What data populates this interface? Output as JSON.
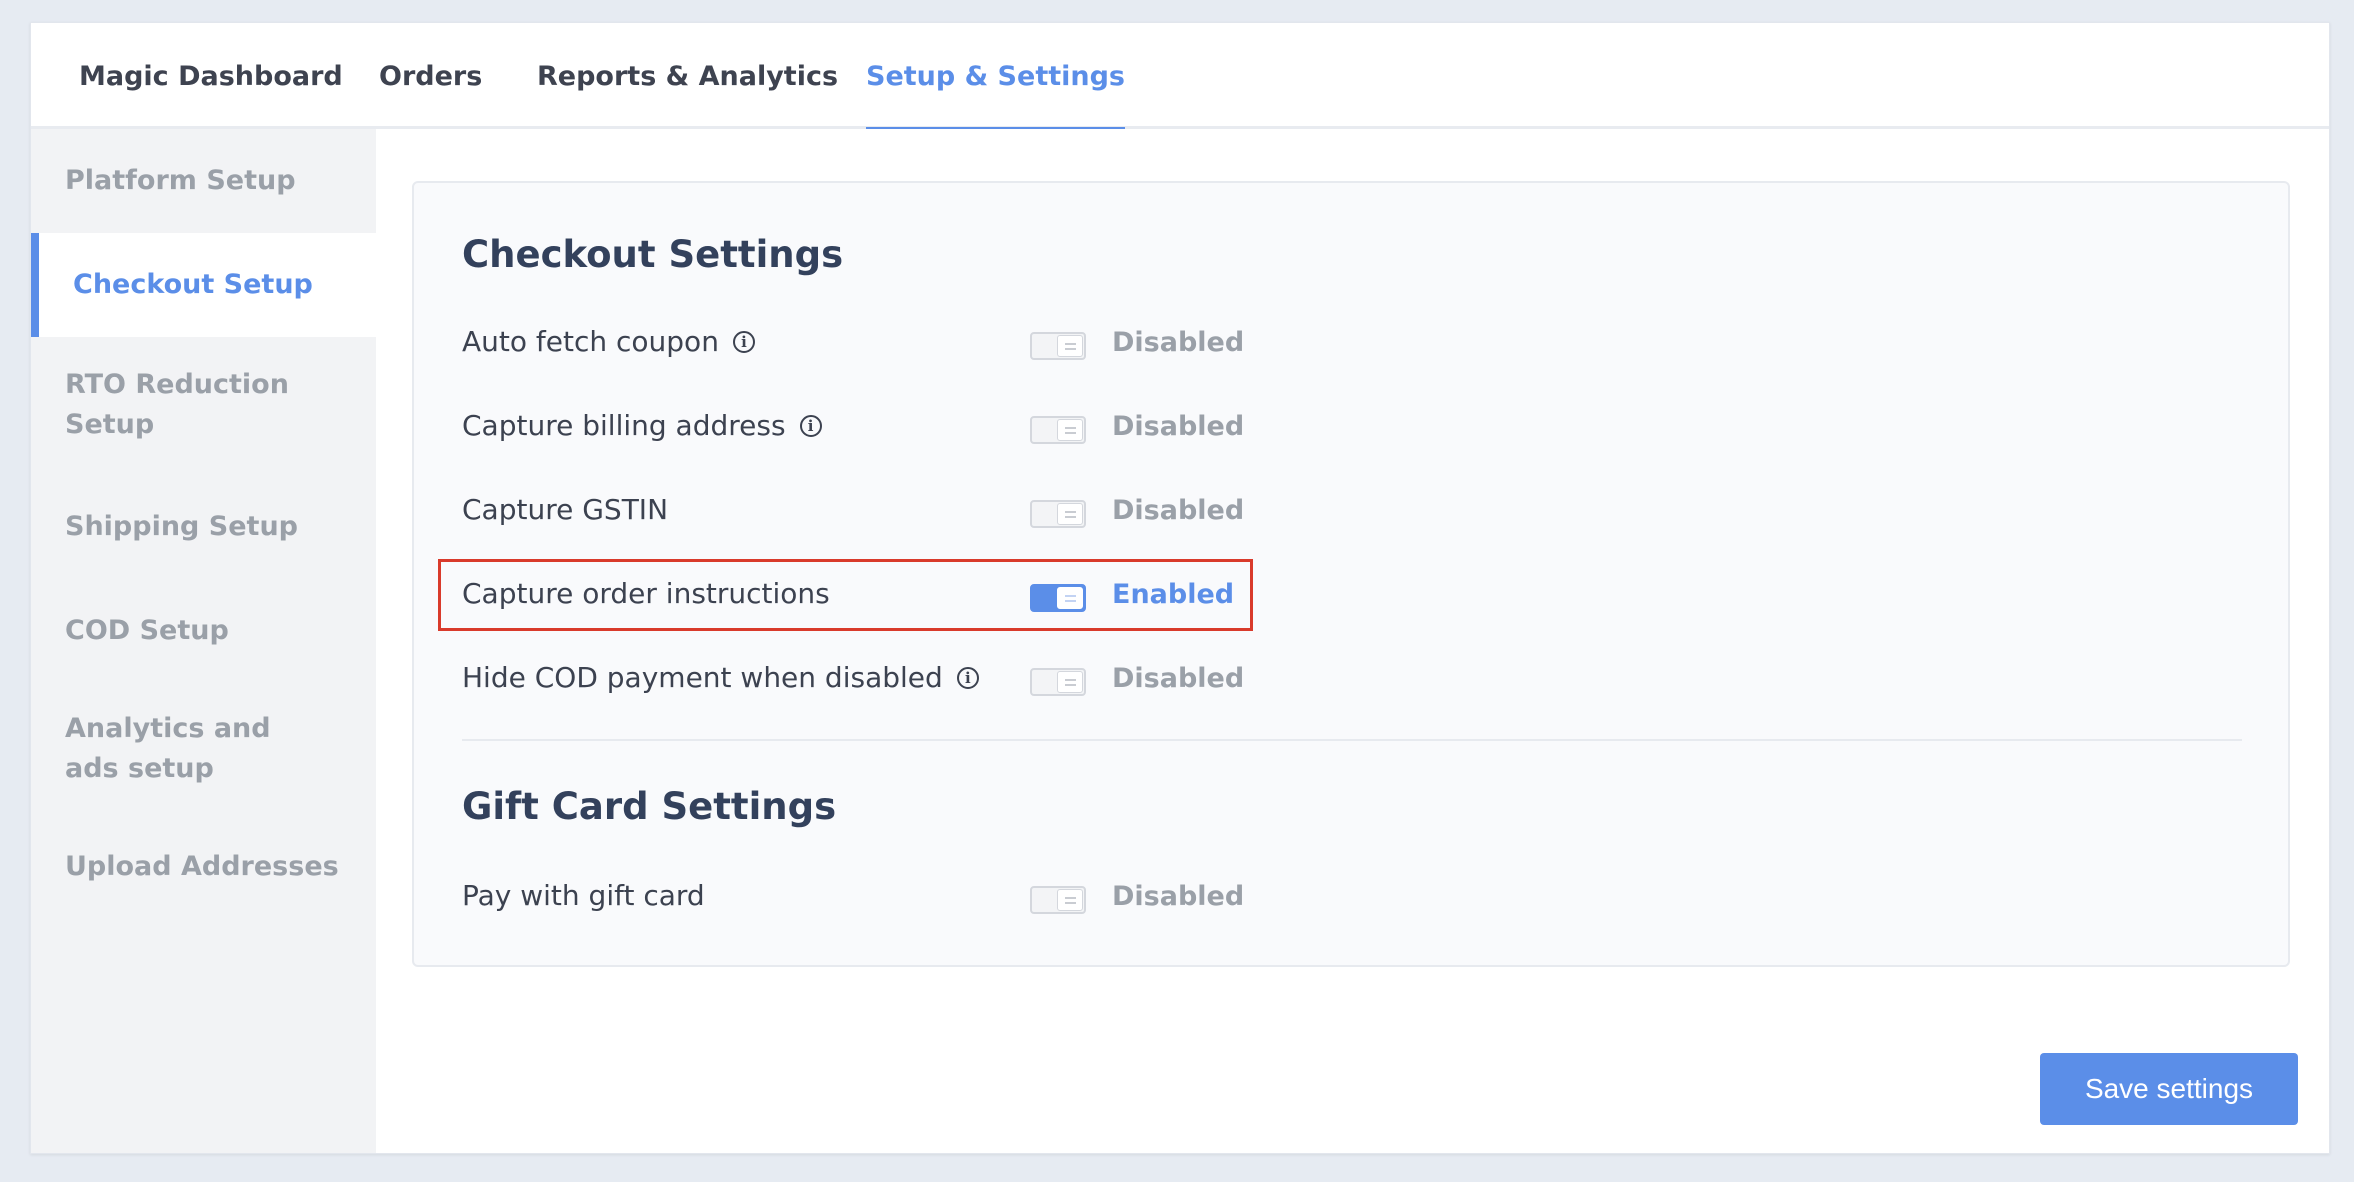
{
  "topnav": {
    "tabs": [
      {
        "label": "Magic Dashboard"
      },
      {
        "label": "Orders"
      },
      {
        "label": "Reports & Analytics"
      },
      {
        "label": "Setup & Settings",
        "active": true
      }
    ]
  },
  "sidebar": {
    "items": [
      {
        "label": "Platform Setup"
      },
      {
        "label": "Checkout Setup",
        "active": true
      },
      {
        "label": "RTO Reduction Setup"
      },
      {
        "label": "Shipping Setup"
      },
      {
        "label": "COD Setup"
      },
      {
        "label": "Analytics and ads setup"
      },
      {
        "label": "Upload Addresses"
      }
    ]
  },
  "checkout": {
    "title": "Checkout Settings",
    "settings": [
      {
        "label": "Auto fetch coupon",
        "info": true,
        "status": "Disabled",
        "enabled": false
      },
      {
        "label": "Capture billing address",
        "info": true,
        "status": "Disabled",
        "enabled": false
      },
      {
        "label": "Capture GSTIN",
        "info": false,
        "status": "Disabled",
        "enabled": false
      },
      {
        "label": "Capture order instructions",
        "info": false,
        "status": "Enabled",
        "enabled": true
      },
      {
        "label": "Hide COD payment when disabled",
        "info": true,
        "status": "Disabled",
        "enabled": false
      }
    ]
  },
  "gift_card": {
    "title": "Gift Card Settings",
    "settings": [
      {
        "label": "Pay with gift card",
        "info": false,
        "status": "Disabled",
        "enabled": false
      }
    ]
  },
  "actions": {
    "save_label": "Save settings"
  },
  "icons": {
    "info": "info-circle-icon",
    "info_glyph": "i"
  },
  "colors": {
    "accent": "#5b8ee8",
    "highlight": "#d93a2b",
    "muted": "#9aa0a8"
  }
}
